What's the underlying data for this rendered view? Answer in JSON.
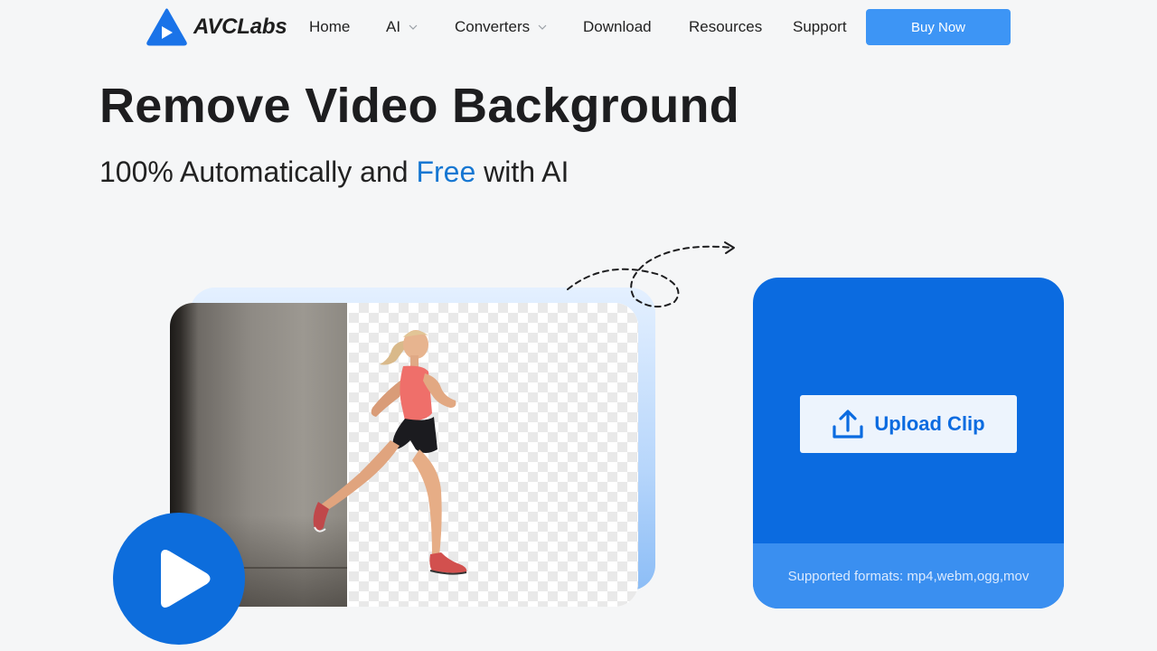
{
  "brand": {
    "name": "AVCLabs"
  },
  "nav": {
    "items": [
      {
        "label": "Home",
        "has_dropdown": false
      },
      {
        "label": "AI",
        "has_dropdown": true
      },
      {
        "label": "Converters",
        "has_dropdown": true
      },
      {
        "label": "Download",
        "has_dropdown": false
      },
      {
        "label": "Resources",
        "has_dropdown": false
      },
      {
        "label": "Support",
        "has_dropdown": false
      }
    ],
    "buy_label": "Buy Now"
  },
  "hero": {
    "title": "Remove Video Background",
    "subtitle_before": "100% Automatically and ",
    "subtitle_accent": "Free",
    "subtitle_after": " with AI"
  },
  "upload": {
    "button_label": "Upload Clip",
    "formats_text": "Supported formats: mp4,webm,ogg,mov"
  },
  "colors": {
    "accent": "#0b6be0",
    "buy_button": "#3d95f5",
    "free_highlight": "#1677d2"
  },
  "icons": [
    "avclabs-logo-icon",
    "chevron-down-icon",
    "play-icon",
    "upload-icon",
    "dashed-arrow-icon"
  ]
}
